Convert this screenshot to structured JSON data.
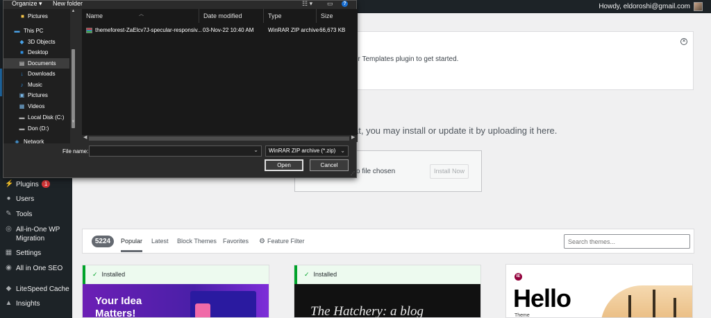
{
  "adminbar": {
    "howdy": "Howdy, eldoroshi@gmail.com"
  },
  "sidebar": {
    "items": [
      {
        "label": "Plugins",
        "icon": "plugin-icon",
        "badge": "1"
      },
      {
        "label": "Users",
        "icon": "users-icon"
      },
      {
        "label": "Tools",
        "icon": "wrench-icon"
      },
      {
        "label": "All-in-One WP Migration",
        "line1": "All-in-One WP",
        "line2": "Migration",
        "icon": "migration-icon"
      },
      {
        "label": "Settings",
        "icon": "settings-icon"
      },
      {
        "label": "All in One SEO",
        "icon": "seo-icon"
      },
      {
        "label": "LiteSpeed Cache",
        "icon": "litespeed-icon"
      },
      {
        "label": "Insights",
        "icon": "insights-icon"
      }
    ]
  },
  "notice": {
    "text": "er Templates plugin to get started."
  },
  "upload": {
    "description": "at, you may install or update it by uploading it here.",
    "no_file": "o file chosen",
    "install_button": "Install Now"
  },
  "filter": {
    "count": "5224",
    "tabs": [
      "Popular",
      "Latest",
      "Block Themes",
      "Favorites"
    ],
    "feature_filter": "Feature Filter",
    "search_placeholder": "Search themes..."
  },
  "themes": {
    "installed_label": "Installed",
    "card1_title_line1": "Your Idea",
    "card1_title_line2": "Matters!",
    "card2_title": "The Hatchery: a blog",
    "card3_title": "Hello",
    "card3_sub": "Theme"
  },
  "dialog": {
    "toolbar": {
      "organize": "Organize ▾",
      "new_folder": "New folder"
    },
    "nav": [
      {
        "label": "Pictures",
        "icon": "folder-icon",
        "color": "#f5c54a"
      },
      {
        "label": "This PC",
        "icon": "computer-icon",
        "color": "#4aa3e8"
      },
      {
        "label": "3D Objects",
        "icon": "cube-icon",
        "color": "#4aa3e8"
      },
      {
        "label": "Desktop",
        "icon": "desktop-icon",
        "color": "#2f8fe0"
      },
      {
        "label": "Documents",
        "icon": "document-icon",
        "color": "#d8d8d8"
      },
      {
        "label": "Downloads",
        "icon": "download-icon",
        "color": "#2f8fe0"
      },
      {
        "label": "Music",
        "icon": "music-icon",
        "color": "#2f8fe0"
      },
      {
        "label": "Pictures",
        "icon": "picture-icon",
        "color": "#7ab8e8"
      },
      {
        "label": "Videos",
        "icon": "video-icon",
        "color": "#7ab8e8"
      },
      {
        "label": "Local Disk (C:)",
        "icon": "disk-icon",
        "color": "#aaaaaa"
      },
      {
        "label": "Don (D:)",
        "icon": "disk-icon",
        "color": "#aaaaaa"
      },
      {
        "label": "Network",
        "icon": "network-icon",
        "color": "#4aa3e8"
      }
    ],
    "columns": [
      "Name",
      "Date modified",
      "Type",
      "Size"
    ],
    "file": {
      "name": "themeforest-ZaElcv7J-specular-responsiv...",
      "date": "03-Nov-22 10:40 AM",
      "type": "WinRAR ZIP archive",
      "size": "66,673 KB"
    },
    "file_name_label": "File name:",
    "file_name_value": "",
    "file_type": "WinRAR ZIP archive (*.zip)",
    "open_button": "Open",
    "cancel_button": "Cancel"
  }
}
